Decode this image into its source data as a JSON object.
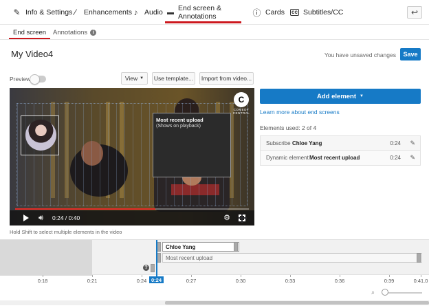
{
  "tabs": [
    {
      "label": "Info & Settings",
      "icon": "pencil-icon"
    },
    {
      "label": "Enhancements",
      "icon": "magic-wand-icon"
    },
    {
      "label": "Audio",
      "icon": "music-note-icon"
    },
    {
      "label": "End screen & Annotations",
      "icon": "end-screen-icon"
    },
    {
      "label": "Cards",
      "icon": "info-circle-icon"
    },
    {
      "label": "Subtitles/CC",
      "icon": "cc-icon"
    }
  ],
  "active_tab": "End screen & Annotations",
  "subtabs": [
    {
      "label": "End screen"
    },
    {
      "label": "Annotations"
    }
  ],
  "video_title": "My Video4",
  "unsaved_text": "You have unsaved changes",
  "save_label": "Save",
  "controls": {
    "preview_label": "Preview",
    "view_label": "View",
    "template_label": "Use template...",
    "import_label": "Import from video..."
  },
  "player": {
    "logo_text": "C",
    "logo_caption": "COMEDY CENTRAL",
    "recent_title": "Most recent upload",
    "recent_sub": "(Shows on playback)",
    "time": "0:24 / 0:40",
    "progress": 0.6
  },
  "panel": {
    "add_element": "Add element",
    "learn_more": "Learn more about end screens",
    "elements_used": "Elements used: 2 of 4",
    "elements": [
      {
        "type": "Subscribe",
        "name": "Chloe Yang",
        "time": "0:24"
      },
      {
        "type": "Dynamic element",
        "name": "Most recent upload",
        "time": "0:24"
      }
    ]
  },
  "hint": "Hold Shift to select multiple elements in the video",
  "timeline": {
    "chloe_label": "Chloe Yang",
    "recent_label": "Most recent upload",
    "playhead_label": "0:24",
    "ticks": [
      "0:18",
      "0:21",
      "0:24",
      "0:27",
      "0:30",
      "0:33",
      "0:36",
      "0:39",
      "0:41.0"
    ]
  },
  "colors": {
    "accent_blue": "#167ac6",
    "tab_red": "#cc181e",
    "progress_red": "#e52d27"
  }
}
